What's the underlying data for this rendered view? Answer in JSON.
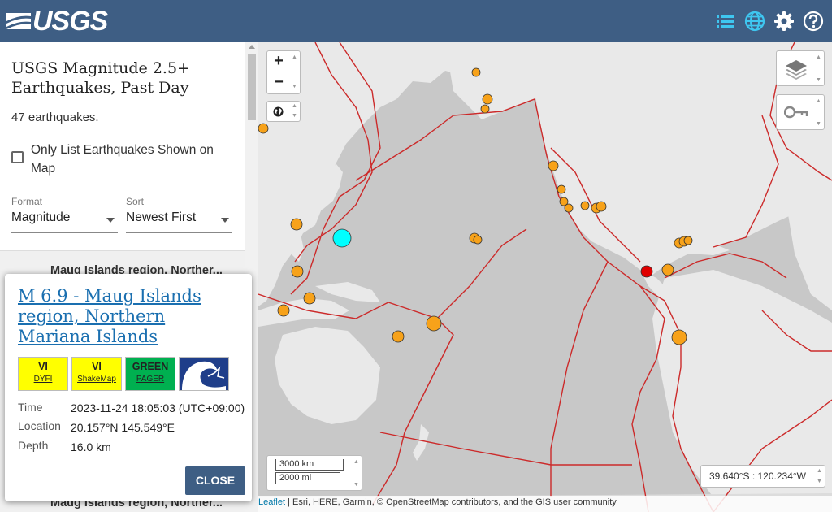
{
  "header": {
    "logo_text": "USGS",
    "icons": [
      "list-icon",
      "globe-icon",
      "gear-icon",
      "help-icon"
    ],
    "bg_color": "#3e5e84",
    "icon_color": "#3ec6f0"
  },
  "sidebar": {
    "title": "USGS Magnitude 2.5+ Earthquakes, Past Day",
    "count": "47 earthquakes.",
    "only_list_label": "Only List Earthquakes Shown on Map",
    "format_label": "Format",
    "format_value": "Magnitude",
    "sort_label": "Sort",
    "sort_value": "Newest First",
    "list_items": [
      {
        "title": "Maug Islands region, Norther..."
      },
      {
        "title": "Maug Islands region, Norther..."
      }
    ]
  },
  "map": {
    "controls": {
      "zoom_in": "+",
      "zoom_out": "−"
    },
    "scale": {
      "km": "3000 km",
      "mi": "2000 mi"
    },
    "coords": "39.640°S : 120.234°W",
    "attribution": {
      "leaflet": "Leaflet",
      "rest": " | Esri, HERE, Garmin, © OpenStreetMap contributors, and the GIS user community"
    }
  },
  "popup": {
    "title": "M 6.9 - Maug Islands region, Northern Mariana Islands",
    "badges": [
      {
        "top": "VI",
        "bottom": "DYFI",
        "color": "#ffff00"
      },
      {
        "top": "VI",
        "bottom": "ShakeMap",
        "color": "#ffff00"
      },
      {
        "top": "GREEN",
        "bottom": "PAGER",
        "color": "#00b050"
      }
    ],
    "tsunami_icon": "tsunami-icon",
    "time_label": "Time",
    "time_value": "2023-11-24 18:05:03 (UTC+09:00)",
    "location_label": "Location",
    "location_value": "20.157°N 145.549°E",
    "depth_label": "Depth",
    "depth_value": "16.0 km",
    "close_label": "CLOSE"
  },
  "quake_colors": {
    "orange": "#f7a21a",
    "selected": "#00ffff",
    "red": "#e00000"
  }
}
